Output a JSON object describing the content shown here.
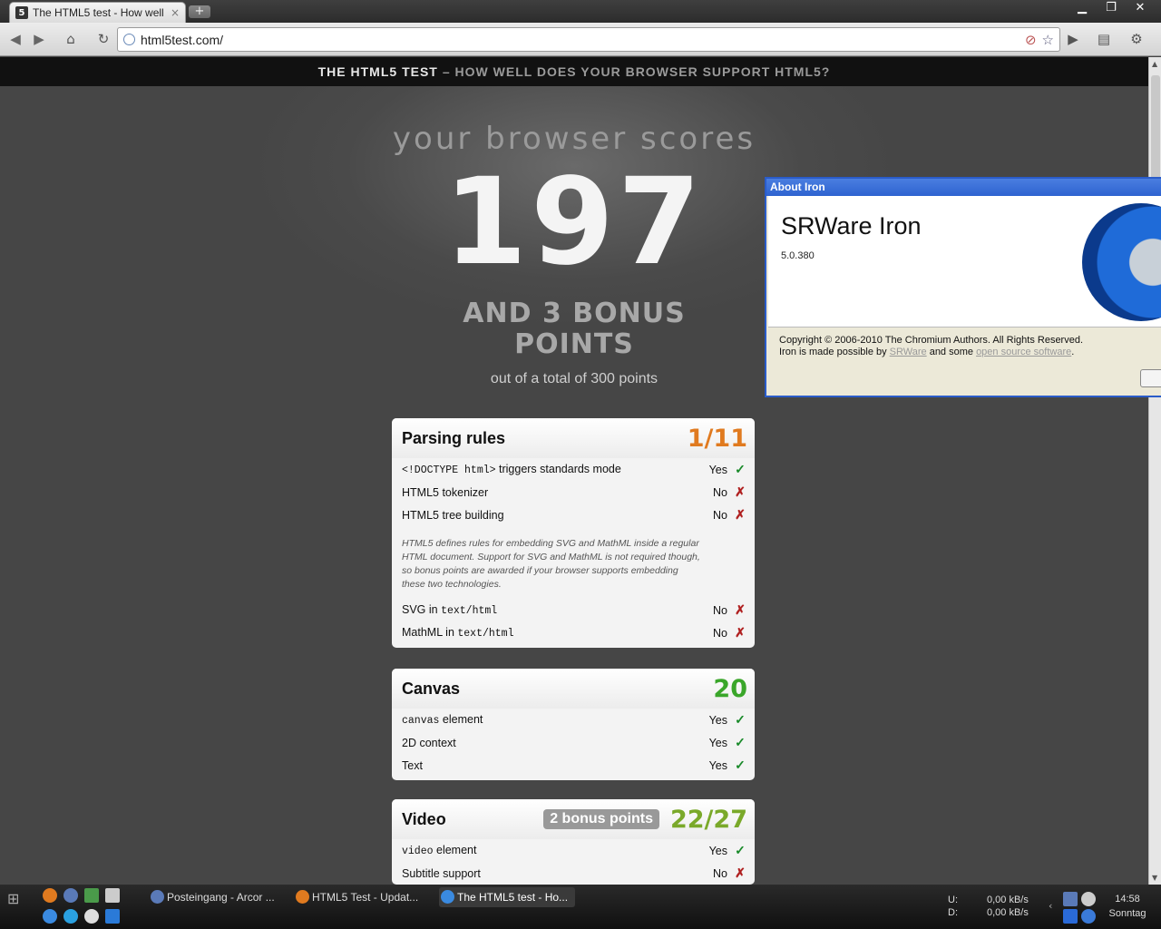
{
  "browser": {
    "tab_title": "The HTML5 test - How well …",
    "tab_close": "×",
    "new_tab": "+",
    "url": "html5test.com/",
    "window_buttons": [
      "▁",
      "❐",
      "✕"
    ]
  },
  "page": {
    "header_main": "THE HTML5 TEST",
    "header_sub": "– HOW WELL DOES YOUR BROWSER SUPPORT HTML5?",
    "scores_label": "your browser scores",
    "score": "197",
    "bonus_line1": "AND 3 BONUS",
    "bonus_line2": "POINTS",
    "total": "out of a total of 300 points"
  },
  "sections": [
    {
      "title": "Parsing rules",
      "score": "1/11",
      "score_color": "#e07a1f",
      "rows": [
        {
          "prefix": "",
          "code": "<!DOCTYPE html>",
          "suffix": " triggers standards mode",
          "value": "Yes",
          "mark": "✓",
          "ok": true
        },
        {
          "prefix": "HTML5 tokenizer",
          "code": "",
          "suffix": "",
          "value": "No",
          "mark": "✗",
          "ok": false
        },
        {
          "prefix": "HTML5 tree building",
          "code": "",
          "suffix": "",
          "value": "No",
          "mark": "✗",
          "ok": false
        }
      ],
      "note": "HTML5 defines rules for embedding SVG and MathML inside a regular HTML document. Support for SVG and MathML is not required though, so bonus points are awarded if your browser supports embedding these two technologies.",
      "rows2": [
        {
          "prefix": "SVG in ",
          "code": "text/html",
          "suffix": "",
          "value": "No",
          "mark": "✗",
          "ok": false
        },
        {
          "prefix": "MathML in ",
          "code": "text/html",
          "suffix": "",
          "value": "No",
          "mark": "✗",
          "ok": false
        }
      ]
    },
    {
      "title": "Canvas",
      "score": "20",
      "score_color": "#3aa62a",
      "rows": [
        {
          "prefix": "",
          "code": "canvas",
          "suffix": " element",
          "value": "Yes",
          "mark": "✓",
          "ok": true
        },
        {
          "prefix": "2D context",
          "code": "",
          "suffix": "",
          "value": "Yes",
          "mark": "✓",
          "ok": true
        },
        {
          "prefix": "Text",
          "code": "",
          "suffix": "",
          "value": "Yes",
          "mark": "✓",
          "ok": true
        }
      ]
    },
    {
      "title": "Video",
      "bonus": "2 bonus points",
      "score": "22/27",
      "score_color": "#7aa92a",
      "rows": [
        {
          "prefix": "",
          "code": "video",
          "suffix": " element",
          "value": "Yes",
          "mark": "✓",
          "ok": true
        },
        {
          "prefix": "Subtitle support",
          "code": "",
          "suffix": "",
          "value": "No",
          "mark": "✗",
          "ok": false
        }
      ]
    }
  ],
  "about": {
    "title": "About Iron",
    "name": "SRWare Iron",
    "version": "5.0.380",
    "copyright": "Copyright © 2006-2010 The Chromium Authors. All Rights Reserved.",
    "made_possible": "Iron is made possible by ",
    "link1": "SRWare",
    "and_some": " and some ",
    "link2": "open source software",
    "period": "."
  },
  "taskbar": {
    "tasks": [
      "Posteingang - Arcor ...",
      "HTML5 Test - Updat...",
      "The HTML5 test - Ho..."
    ],
    "upload_label": "U:",
    "download_label": "D:",
    "upload_rate": "0,00 kB/s",
    "download_rate": "0,00 kB/s",
    "time": "14:58",
    "day": "Sonntag"
  }
}
